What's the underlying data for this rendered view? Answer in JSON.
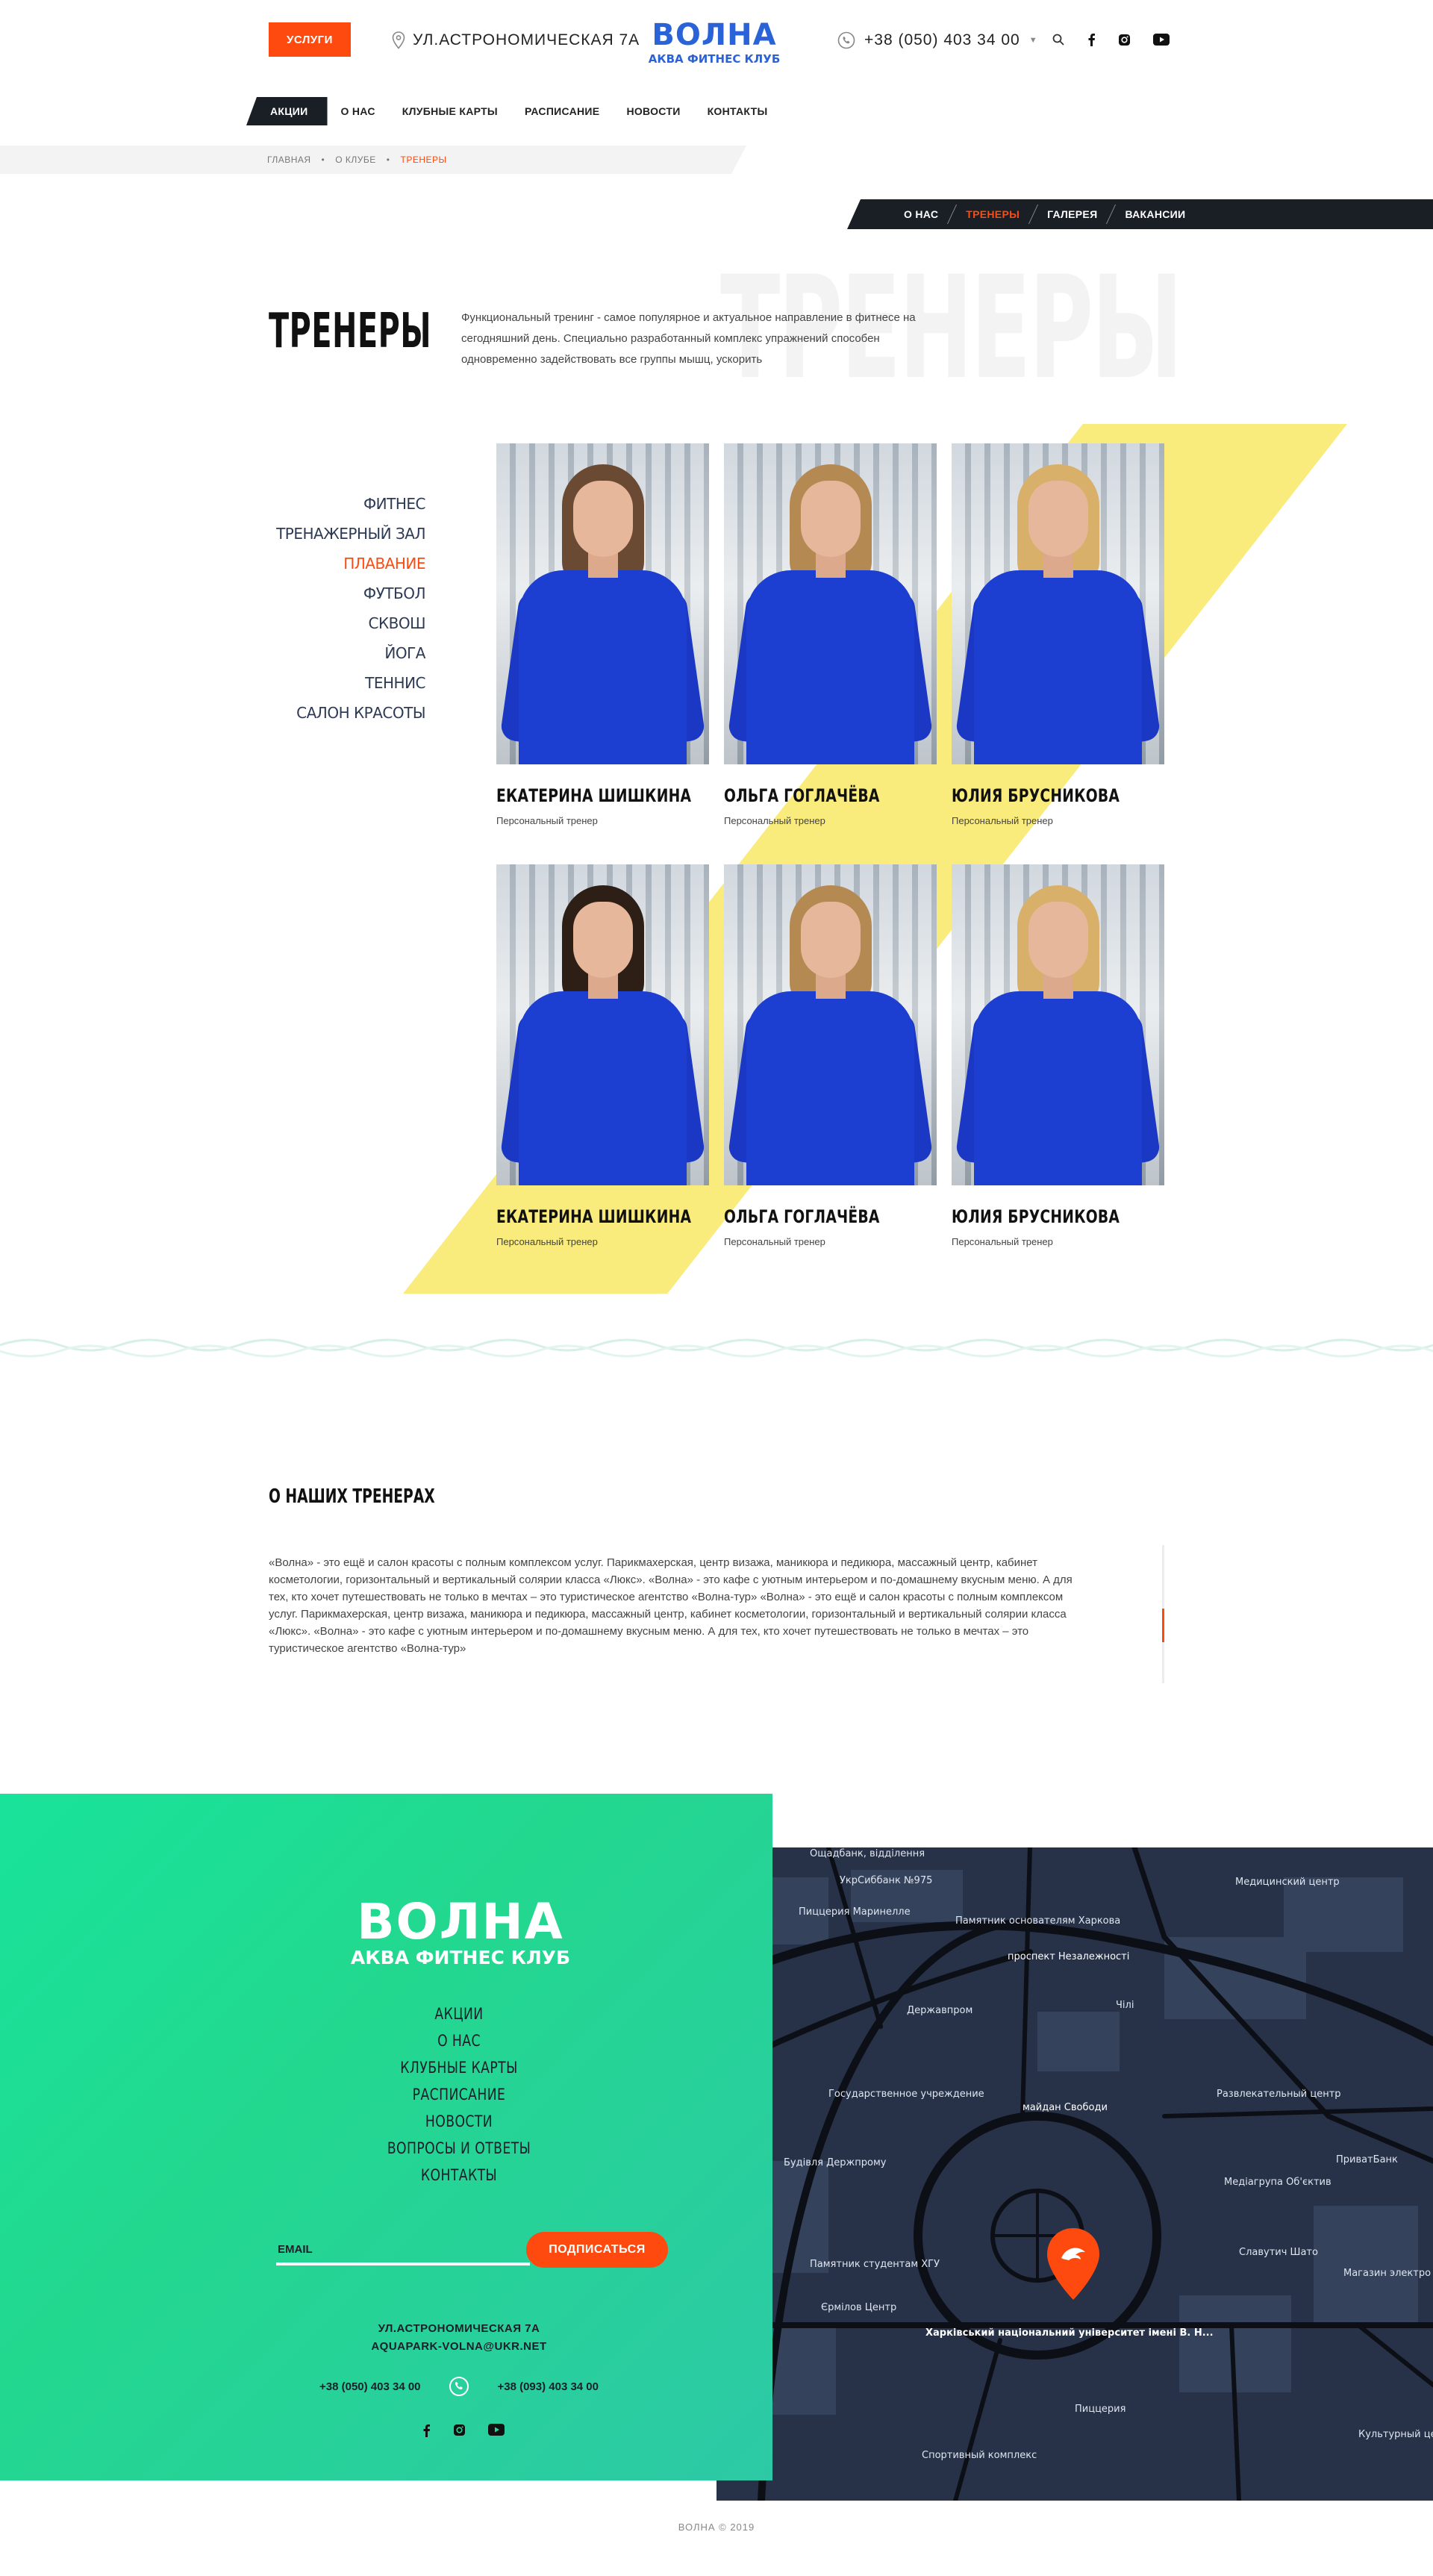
{
  "header": {
    "services_label": "УСЛУГИ",
    "address": "УЛ.АСТРОНОМИЧЕСКАЯ 7А",
    "logo_title": "ВОЛНА",
    "logo_sub": "АКВА  ФИТНЕС КЛУБ",
    "phone": "+38  (050) 403 34 00"
  },
  "nav": [
    "АКЦИИ",
    "О НАС",
    "КЛУБНЫЕ КАРТЫ",
    "РАСПИСАНИЕ",
    "НОВОСТИ",
    "КОНТАКТЫ"
  ],
  "breadcrumbs": [
    "ГЛАВНАЯ",
    "О КЛУБЕ",
    "ТРЕНЕРЫ"
  ],
  "subnav": [
    "О НАС",
    "ТРЕНЕРЫ",
    "ГАЛЕРЕЯ",
    "ВАКАНСИИ"
  ],
  "page": {
    "bg_word": "ТРЕНЕРЫ",
    "title": "ТРЕНЕРЫ",
    "intro": "Функциональный тренинг - самое популярное и актуальное направление в фитнесе на сегодняшний день. Специально разработанный комплекс упражнений способен одновременно задействовать все группы мышц, ускорить"
  },
  "categories": [
    "ФИТНЕС",
    "ТРЕНАЖЕРНЫЙ ЗАЛ",
    "ПЛАВАНИЕ",
    "ФУТБОЛ",
    "СКВОШ",
    "ЙОГА",
    "ТЕННИС",
    "САЛОН КРАСОТЫ"
  ],
  "trainers": [
    {
      "name": "ЕКАТЕРИНА ШИШКИНА",
      "role": "Персональный тренер"
    },
    {
      "name": "ОЛЬГА ГОГЛАЧЁВА",
      "role": "Персональный тренер"
    },
    {
      "name": "ЮЛИЯ БРУСНИКОВА",
      "role": "Персональный тренер"
    },
    {
      "name": "ЕКАТЕРИНА ШИШКИНА",
      "role": "Персональный тренер"
    },
    {
      "name": "ОЛЬГА ГОГЛАЧЁВА",
      "role": "Персональный тренер"
    },
    {
      "name": "ЮЛИЯ БРУСНИКОВА",
      "role": "Персональный тренер"
    }
  ],
  "about": {
    "title": "О НАШИХ ТРЕНЕРАХ",
    "text": "«Волна» - это ещё и салон красоты с полным комплексом услуг. Парикмахерская, центр визажа, маникюра и педикюра, массажный центр, кабинет косметологии, горизонтальный и вертикальный солярии класса «Люкс». «Волна» - это кафе с уютным интерьером и по-домашнему вкусным меню. А для тех, кто хочет путешествовать не только в мечтах – это туристическое агентство «Волна-тур» «Волна» - это ещё и салон красоты с полным комплексом услуг. Парикмахерская, центр визажа, маникюра и педикюра, массажный центр, кабинет косметологии, горизонтальный и вертикальный солярии класса «Люкс». «Волна» - это кафе с уютным интерьером и по-домашнему вкусным меню. А для тех, кто хочет путешествовать не только в мечтах – это туристическое агентство «Волна-тур»"
  },
  "footer": {
    "logo_title": "ВОЛНА",
    "logo_sub": "АКВА  ФИТНЕС КЛУБ",
    "menu": [
      "АКЦИИ",
      "О НАС",
      "КЛУБНЫЕ КАРТЫ",
      "РАСПИСАНИЕ",
      "НОВОСТИ",
      "ВОПРОСЫ И ОТВЕТЫ",
      "КОНТАКТЫ"
    ],
    "email_placeholder": "EMAIL",
    "subscribe_label": "ПОДПИСАТЬСЯ",
    "address": "УЛ.АСТРОНОМИЧЕСКАЯ 7А",
    "email": "AQUAPARK-VOLNA@UKR.NET",
    "phone1": "+38 (050) 403 34 00",
    "phone2": "+38 (093) 403 34 00",
    "copyright": "ВОЛНА © 2019"
  },
  "map_labels": [
    {
      "text": "Ощадбанк, відділення"
    },
    {
      "text": "УкрСиббанк №975"
    },
    {
      "text": "Пиццерия Маринелле"
    },
    {
      "text": "Памятник основателям Харкова"
    },
    {
      "text": "проспект Незалежності"
    },
    {
      "text": "Медицинский центр"
    },
    {
      "text": "Державпром"
    },
    {
      "text": "Чілі"
    },
    {
      "text": "Государственное учреждение"
    },
    {
      "text": "майдан Свободи"
    },
    {
      "text": "Развлекательный центр"
    },
    {
      "text": "ПриватБанк"
    },
    {
      "text": "Будівля Держпрому"
    },
    {
      "text": "Медіагрупа Об'єктив"
    },
    {
      "text": "Памятник студентам ХГУ"
    },
    {
      "text": "Єрмілов Центр"
    },
    {
      "text": "Харківський національний університет імені В. Н..."
    },
    {
      "text": "Славутич Шато"
    },
    {
      "text": "Магазин электро"
    },
    {
      "text": "Пиццерия"
    },
    {
      "text": "Спортивный комплекс"
    },
    {
      "text": "Культурный центр"
    }
  ],
  "colors": {
    "accent": "#ff4a0f",
    "dark": "#1a1f26",
    "green": "#1fdf95",
    "yellow": "#f9ec7c",
    "blue": "#1d3fd1"
  }
}
